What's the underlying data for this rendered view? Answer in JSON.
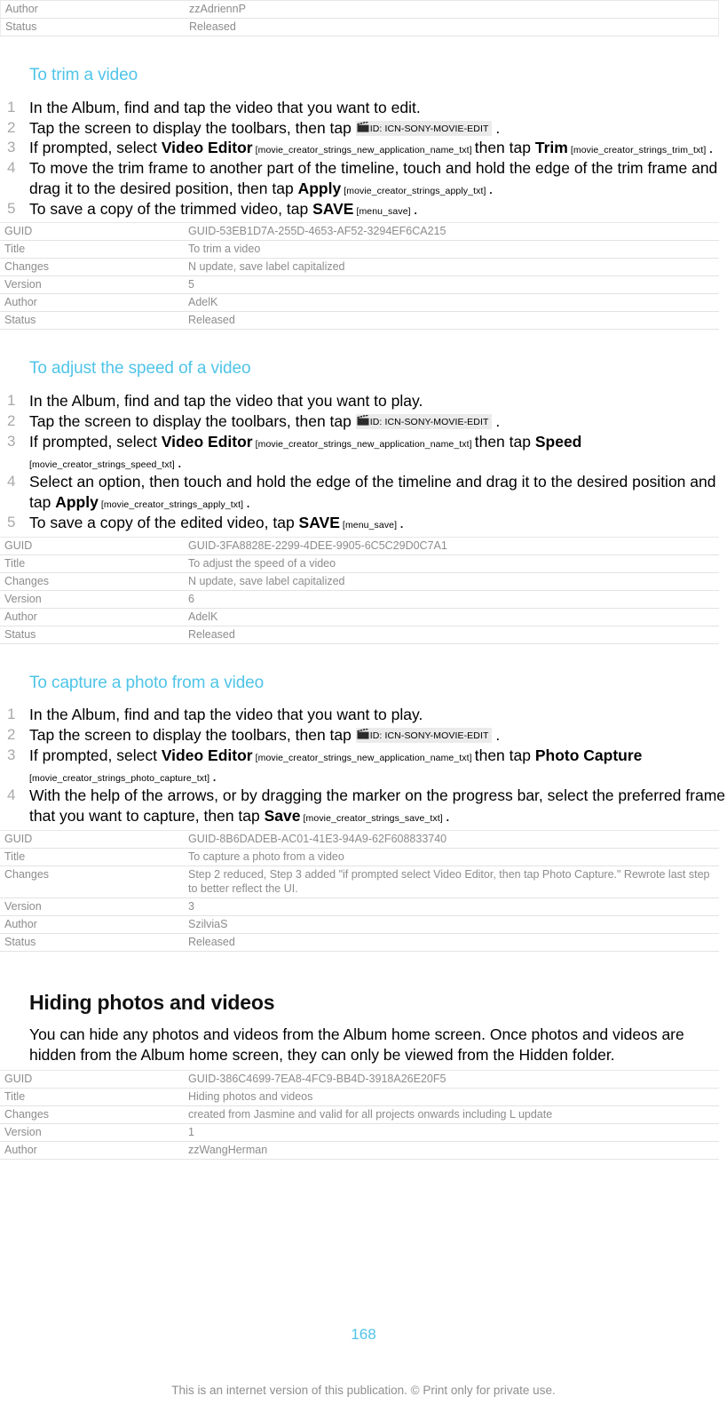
{
  "document": {
    "page_number": "168",
    "footer_note": "This is an internet version of this publication. © Print only for private use.",
    "accent_color": "#4FC4E8"
  },
  "top_meta_table": {
    "rows": [
      {
        "key": "Author",
        "value": "zzAdriennP"
      },
      {
        "key": "Status",
        "value": "Released"
      }
    ]
  },
  "sections": [
    {
      "heading": "To trim a video",
      "steps": [
        {
          "num": "1",
          "parts": [
            {
              "type": "text",
              "text": "In the Album, find and tap the video that you want to edit."
            }
          ]
        },
        {
          "num": "2",
          "parts": [
            {
              "type": "text",
              "text": "Tap the screen to display the toolbars, then tap "
            },
            {
              "type": "icon",
              "icon": "movie-edit-clapperboard-icon",
              "label": "ID: ICN-SONY-MOVIE-EDIT"
            },
            {
              "type": "text",
              "text": " ."
            }
          ]
        },
        {
          "num": "3",
          "parts": [
            {
              "type": "text",
              "text": "If prompted, select "
            },
            {
              "type": "uiterm",
              "text": "Video Editor"
            },
            {
              "type": "strid",
              "text": " [movie_creator_strings_new_application_name_txt] "
            },
            {
              "type": "text",
              "text": "then tap "
            },
            {
              "type": "uiterm",
              "text": "Trim"
            },
            {
              "type": "strid",
              "text": " [movie_creator_strings_trim_txt] "
            },
            {
              "type": "text",
              "text": "."
            }
          ]
        },
        {
          "num": "4",
          "parts": [
            {
              "type": "text",
              "text": "To move the trim frame to another part of the timeline, touch and hold the edge of the trim frame and drag it to the desired position, then tap "
            },
            {
              "type": "uiterm",
              "text": "Apply"
            },
            {
              "type": "strid",
              "text": " [movie_creator_strings_apply_txt] "
            },
            {
              "type": "text",
              "text": "."
            }
          ]
        },
        {
          "num": "5",
          "parts": [
            {
              "type": "text",
              "text": "To save a copy of the trimmed video, tap "
            },
            {
              "type": "uiterm",
              "text": "SAVE"
            },
            {
              "type": "strid",
              "text": " [menu_save] "
            },
            {
              "type": "text",
              "text": "."
            }
          ]
        }
      ],
      "meta": {
        "rows": [
          {
            "key": "GUID",
            "value": "GUID-53EB1D7A-255D-4653-AF52-3294EF6CA215"
          },
          {
            "key": "Title",
            "value": "To trim a video"
          },
          {
            "key": "Changes",
            "value": "N update, save label capitalized"
          },
          {
            "key": "Version",
            "value": "5"
          },
          {
            "key": "Author",
            "value": "AdelK"
          },
          {
            "key": "Status",
            "value": "Released"
          }
        ]
      }
    },
    {
      "heading": "To adjust the speed of a video",
      "steps": [
        {
          "num": "1",
          "parts": [
            {
              "type": "text",
              "text": "In the Album, find and tap the video that you want to play."
            }
          ]
        },
        {
          "num": "2",
          "parts": [
            {
              "type": "text",
              "text": "Tap the screen to display the toolbars, then tap "
            },
            {
              "type": "icon",
              "icon": "movie-edit-clapperboard-icon",
              "label": "ID: ICN-SONY-MOVIE-EDIT"
            },
            {
              "type": "text",
              "text": " ."
            }
          ]
        },
        {
          "num": "3",
          "parts": [
            {
              "type": "text",
              "text": "If prompted, select "
            },
            {
              "type": "uiterm",
              "text": "Video Editor"
            },
            {
              "type": "strid",
              "text": " [movie_creator_strings_new_application_name_txt] "
            },
            {
              "type": "text",
              "text": "then tap "
            },
            {
              "type": "uiterm",
              "text": "Speed"
            },
            {
              "type": "strid",
              "text": " [movie_creator_strings_speed_txt] "
            },
            {
              "type": "text",
              "text": "."
            }
          ]
        },
        {
          "num": "4",
          "parts": [
            {
              "type": "text",
              "text": "Select an option, then touch and hold the edge of the timeline and drag it to the desired position and tap "
            },
            {
              "type": "uiterm",
              "text": "Apply"
            },
            {
              "type": "strid",
              "text": " [movie_creator_strings_apply_txt] "
            },
            {
              "type": "text",
              "text": "."
            }
          ]
        },
        {
          "num": "5",
          "parts": [
            {
              "type": "text",
              "text": "To save a copy of the edited video, tap "
            },
            {
              "type": "uiterm",
              "text": "SAVE"
            },
            {
              "type": "strid",
              "text": " [menu_save] "
            },
            {
              "type": "text",
              "text": "."
            }
          ]
        }
      ],
      "meta": {
        "rows": [
          {
            "key": "GUID",
            "value": "GUID-3FA8828E-2299-4DEE-9905-6C5C29D0C7A1"
          },
          {
            "key": "Title",
            "value": "To adjust the speed of a video"
          },
          {
            "key": "Changes",
            "value": "N update, save label capitalized"
          },
          {
            "key": "Version",
            "value": "6"
          },
          {
            "key": "Author",
            "value": "AdelK"
          },
          {
            "key": "Status",
            "value": "Released"
          }
        ]
      }
    },
    {
      "heading": "To capture a photo from a video",
      "steps": [
        {
          "num": "1",
          "parts": [
            {
              "type": "text",
              "text": "In the Album, find and tap the video that you want to play."
            }
          ]
        },
        {
          "num": "2",
          "parts": [
            {
              "type": "text",
              "text": "Tap the screen to display the toolbars, then tap "
            },
            {
              "type": "icon",
              "icon": "movie-edit-clapperboard-icon",
              "label": "ID: ICN-SONY-MOVIE-EDIT"
            },
            {
              "type": "text",
              "text": " ."
            }
          ]
        },
        {
          "num": "3",
          "parts": [
            {
              "type": "text",
              "text": "If prompted, select "
            },
            {
              "type": "uiterm",
              "text": "Video Editor"
            },
            {
              "type": "strid",
              "text": " [movie_creator_strings_new_application_name_txt] "
            },
            {
              "type": "text",
              "text": "then tap "
            },
            {
              "type": "uiterm",
              "text": "Photo Capture"
            },
            {
              "type": "strid",
              "text": " [movie_creator_strings_photo_capture_txt] "
            },
            {
              "type": "text",
              "text": "."
            }
          ]
        },
        {
          "num": "4",
          "parts": [
            {
              "type": "text",
              "text": "With the help of the arrows, or by dragging the marker on the progress bar, select the preferred frame that you want to capture, then tap "
            },
            {
              "type": "uiterm",
              "text": "Save"
            },
            {
              "type": "strid",
              "text": " [movie_creator_strings_save_txt] "
            },
            {
              "type": "text",
              "text": "."
            }
          ]
        }
      ],
      "meta": {
        "rows": [
          {
            "key": "GUID",
            "value": "GUID-8B6DADEB-AC01-41E3-94A9-62F608833740"
          },
          {
            "key": "Title",
            "value": "To capture a photo from a video"
          },
          {
            "key": "Changes",
            "value": "Step 2 reduced, Step 3 added \"if prompted select Video Editor, then tap Photo Capture.\" Rewrote last step to better reflect the UI."
          },
          {
            "key": "Version",
            "value": "3"
          },
          {
            "key": "Author",
            "value": "SzilviaS"
          },
          {
            "key": "Status",
            "value": "Released"
          }
        ]
      }
    }
  ],
  "chapter": {
    "heading": "Hiding photos and videos",
    "body": "You can hide any photos and videos from the Album home screen. Once photos and videos are hidden from the Album home screen, they can only be viewed from the Hidden folder.",
    "meta": {
      "rows": [
        {
          "key": "GUID",
          "value": "GUID-386C4699-7EA8-4FC9-BB4D-3918A26E20F5"
        },
        {
          "key": "Title",
          "value": "Hiding photos and videos"
        },
        {
          "key": "Changes",
          "value": "created from Jasmine and valid for all projects onwards including L update"
        },
        {
          "key": "Version",
          "value": "1"
        },
        {
          "key": "Author",
          "value": "zzWangHerman"
        }
      ]
    }
  }
}
